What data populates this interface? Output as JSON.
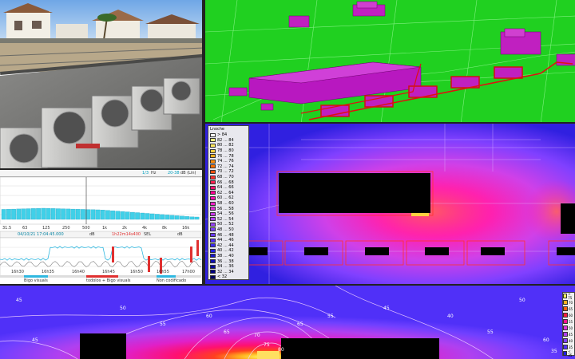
{
  "analyzer": {
    "header": {
      "hz_value": "1/3",
      "hz_unit": "Hz",
      "db_range": "20-38",
      "db_unit": "dB (Lin)"
    },
    "frequency_ticks": [
      "31.5",
      "63",
      "125",
      "250",
      "500",
      "1k",
      "2k",
      "4k",
      "8k",
      "16k"
    ],
    "status": {
      "time": "04/10/21 17:04:45.000",
      "level_field": "dB",
      "duration": "1h22m14s400",
      "metric": "SEL",
      "metric_unit": "dB"
    },
    "time_ticks": [
      "16h30",
      "16h35",
      "16h40",
      "16h45",
      "16h50",
      "16h55",
      "17h00"
    ],
    "footer": [
      "Bigo visuals",
      "todolos + Bigo visuals",
      "Non codificado"
    ]
  },
  "noisemap": {
    "legend_title": "Lnoche",
    "legend_items": [
      {
        "label": "> 84",
        "color": "#ffffff"
      },
      {
        "label": "82 ... 84",
        "color": "#ffff80"
      },
      {
        "label": "80 ... 82",
        "color": "#ffe860"
      },
      {
        "label": "78 ... 80",
        "color": "#ffd040"
      },
      {
        "label": "76 ... 78",
        "color": "#ffb020"
      },
      {
        "label": "74 ... 76",
        "color": "#ff9010"
      },
      {
        "label": "72 ... 74",
        "color": "#ff7000"
      },
      {
        "label": "70 ... 72",
        "color": "#ff5010"
      },
      {
        "label": "68 ... 70",
        "color": "#ff3030"
      },
      {
        "label": "66 ... 68",
        "color": "#ff2050"
      },
      {
        "label": "64 ... 66",
        "color": "#ff1070"
      },
      {
        "label": "62 ... 64",
        "color": "#ff0090"
      },
      {
        "label": "60 ... 62",
        "color": "#ff10b0"
      },
      {
        "label": "58 ... 60",
        "color": "#f020c8"
      },
      {
        "label": "56 ... 58",
        "color": "#e030d8"
      },
      {
        "label": "54 ... 56",
        "color": "#c838e8"
      },
      {
        "label": "52 ... 54",
        "color": "#b040f0"
      },
      {
        "label": "50 ... 52",
        "color": "#9840f8"
      },
      {
        "label": "48 ... 50",
        "color": "#8040ff"
      },
      {
        "label": "46 ... 48",
        "color": "#6838ff"
      },
      {
        "label": "44 ... 46",
        "color": "#5030f8"
      },
      {
        "label": "42 ... 44",
        "color": "#3828f0"
      },
      {
        "label": "40 ... 42",
        "color": "#2020e0"
      },
      {
        "label": "38 ... 40",
        "color": "#1818c8"
      },
      {
        "label": "36 ... 38",
        "color": "#1010b0"
      },
      {
        "label": "34 ... 36",
        "color": "#080898"
      },
      {
        "label": "32 ... 34",
        "color": "#000080"
      },
      {
        "label": "< 32",
        "color": "#000060"
      }
    ]
  },
  "contour": {
    "labels": [
      "45",
      "50",
      "55",
      "60",
      "65",
      "70",
      "75",
      "80",
      "65",
      "55",
      "45",
      "40",
      "55",
      "50",
      "60",
      "45",
      "35"
    ],
    "legend_items": [
      {
        "label": "> 75",
        "color": "#ffff60"
      },
      {
        "label": "70",
        "color": "#ffb020"
      },
      {
        "label": "65",
        "color": "#ff6010"
      },
      {
        "label": "60",
        "color": "#ff2040"
      },
      {
        "label": "55",
        "color": "#ff1090"
      },
      {
        "label": "50",
        "color": "#e030d8"
      },
      {
        "label": "45",
        "color": "#b040f0"
      },
      {
        "label": "40",
        "color": "#8040ff"
      },
      {
        "label": "35",
        "color": "#5030f8"
      },
      {
        "label": "< 35",
        "color": "#2020e0"
      }
    ]
  }
}
